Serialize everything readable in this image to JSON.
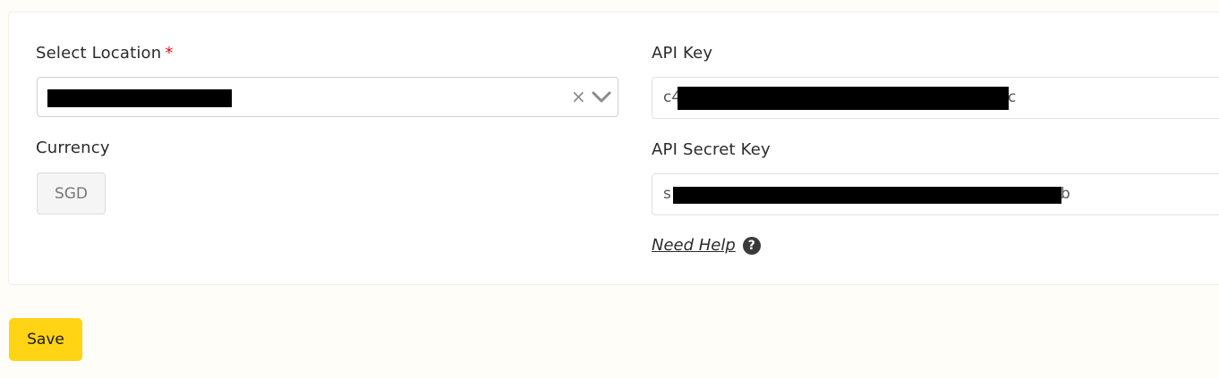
{
  "form": {
    "location_label": "Select Location",
    "required_mark": "*",
    "currency_label": "Currency",
    "currency_value": "SGD",
    "api_key_label": "API Key",
    "api_key_prefix": "c4",
    "api_key_suffix": "c",
    "api_secret_label": "API Secret Key",
    "api_secret_prefix": "s",
    "api_secret_suffix": "b",
    "help_link": "Need Help",
    "help_icon": "?"
  },
  "icons": {
    "clear": "clear-icon",
    "chevron": "chevron-down-icon",
    "help": "question-circle-icon"
  },
  "actions": {
    "save_label": "Save"
  },
  "colors": {
    "accent": "#ffd414",
    "required": "#dd1111"
  }
}
